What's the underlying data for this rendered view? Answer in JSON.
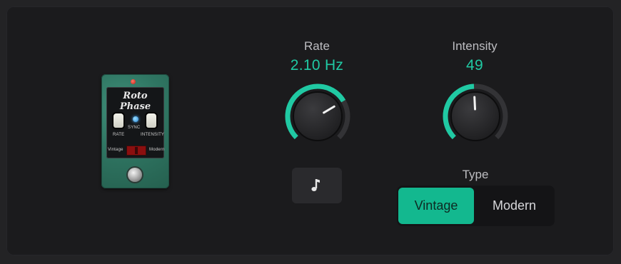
{
  "pedal": {
    "title": "Roto Phase",
    "rate_label": "RATE",
    "sync_label": "SYNC",
    "intensity_label": "INTENSITY",
    "vintage_label": "Vintage",
    "modern_label": "Modern"
  },
  "rate": {
    "label": "Rate",
    "value": "2.10 Hz",
    "level": 0.72
  },
  "intensity": {
    "label": "Intensity",
    "value": "49",
    "level": 0.49
  },
  "sync": {
    "icon": "music-note-icon"
  },
  "type": {
    "label": "Type",
    "options": [
      "Vintage",
      "Modern"
    ],
    "selected": "Vintage"
  },
  "colors": {
    "accent": "#20c9a3",
    "selected_button": "#13b88f",
    "knob_track": "#333336"
  }
}
